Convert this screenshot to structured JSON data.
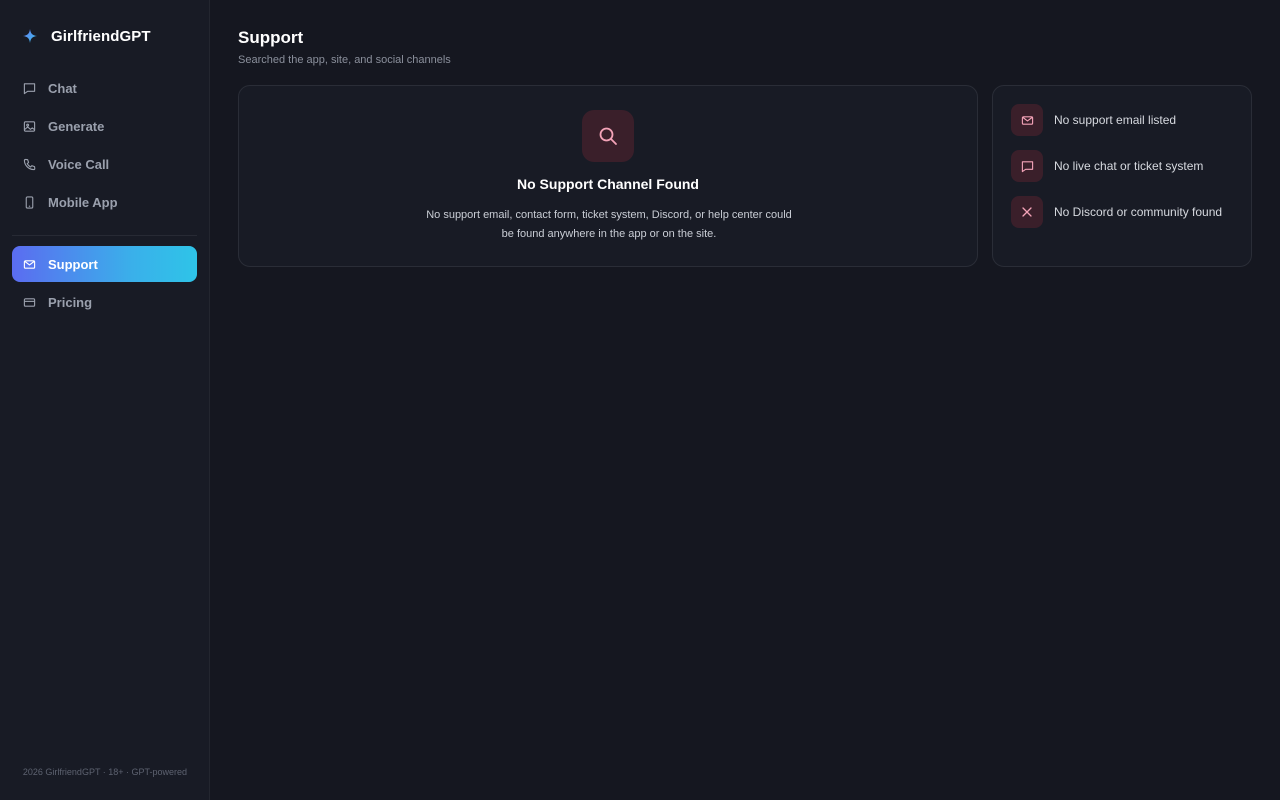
{
  "app": {
    "name": "GirlfriendGPT",
    "logo_icon": "sparkle-icon"
  },
  "sidebar": {
    "items": [
      {
        "label": "Chat",
        "icon": "chat-bubble-icon",
        "active": false
      },
      {
        "label": "Generate",
        "icon": "image-icon",
        "active": false
      },
      {
        "label": "Voice Call",
        "icon": "phone-icon",
        "active": false
      },
      {
        "label": "Mobile App",
        "icon": "smartphone-icon",
        "active": false
      },
      {
        "label": "Support",
        "icon": "mail-icon",
        "active": true
      },
      {
        "label": "Pricing",
        "icon": "credit-card-icon",
        "active": false
      }
    ],
    "footer": "2026 GirlfriendGPT · 18+ · GPT-powered"
  },
  "page": {
    "title": "Support",
    "subtitle": "Searched the app, site, and social channels"
  },
  "empty_state": {
    "icon": "search-icon",
    "title": "No Support Channel Found",
    "description": "No support email, contact form, ticket system, Discord, or help center could be found anywhere in the app or on the site."
  },
  "findings": [
    {
      "label": "No support email listed",
      "icon": "mail-icon"
    },
    {
      "label": "No live chat or ticket system",
      "icon": "chat-bubble-icon"
    },
    {
      "label": "No Discord or community found",
      "icon": "x-icon"
    }
  ],
  "colors": {
    "background": "#151720",
    "sidebar": "#181b25",
    "accent_gradient_start": "#5b6cf0",
    "accent_gradient_end": "#2ec4e8",
    "icon_tile": "#3a1f2a",
    "icon_pink": "#f4a3b8"
  }
}
